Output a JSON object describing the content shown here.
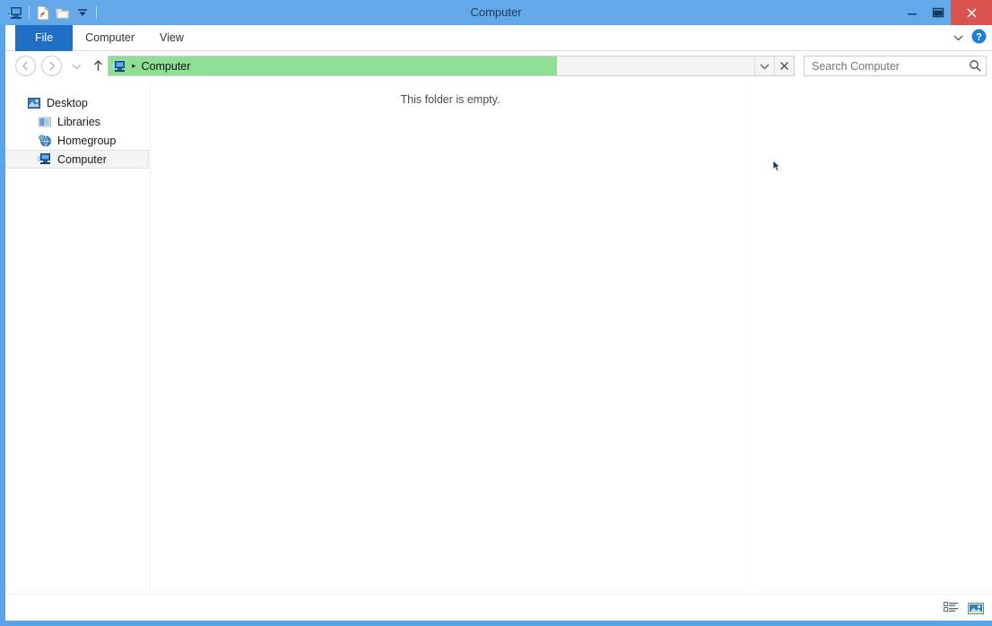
{
  "window": {
    "title": "Computer",
    "accent_blue": "#63a9e9",
    "close_red": "#d9534f"
  },
  "quick_access": {
    "items": [
      {
        "name": "computer-icon",
        "label": "Computer"
      },
      {
        "name": "properties-icon",
        "label": "Properties"
      },
      {
        "name": "new-folder-icon",
        "label": "New folder"
      },
      {
        "name": "customize-qat-icon",
        "label": "Customize Quick Access Toolbar"
      }
    ]
  },
  "window_controls": {
    "minimize": "—",
    "maximize": "❐",
    "close": "✕"
  },
  "ribbon": {
    "tabs": [
      {
        "label": "File",
        "active": true
      },
      {
        "label": "Computer",
        "active": false
      },
      {
        "label": "View",
        "active": false
      }
    ],
    "minimize_ribbon_icon": "chevron-down-icon",
    "help_icon": "help-icon",
    "help_label": "?"
  },
  "navigation": {
    "back_label": "←",
    "forward_label": "→",
    "recent_label": "▾",
    "up_label": "↑"
  },
  "address_bar": {
    "breadcrumbs": [
      {
        "label": "Computer",
        "icon": "computer-icon"
      }
    ],
    "separator": "▸",
    "highlight_color": "#8ede96",
    "dropdown_label": "⌄",
    "stop_label": "✕"
  },
  "search": {
    "placeholder": "Search Computer",
    "value": "",
    "icon": "search-icon"
  },
  "sidebar": {
    "items": [
      {
        "label": "Desktop",
        "icon": "desktop-icon",
        "depth": 0,
        "selected": false
      },
      {
        "label": "Libraries",
        "icon": "libraries-icon",
        "depth": 1,
        "selected": false
      },
      {
        "label": "Homegroup",
        "icon": "homegroup-icon",
        "depth": 1,
        "selected": false
      },
      {
        "label": "Computer",
        "icon": "computer-icon",
        "depth": 1,
        "selected": true
      }
    ]
  },
  "content": {
    "empty_message": "This folder is empty."
  },
  "status_bar": {
    "item_count_text": "",
    "view_toggles": [
      {
        "name": "details-view-icon",
        "label": "Details view",
        "active": false
      },
      {
        "name": "large-icons-view-icon",
        "label": "Large icons view",
        "active": true
      }
    ]
  }
}
